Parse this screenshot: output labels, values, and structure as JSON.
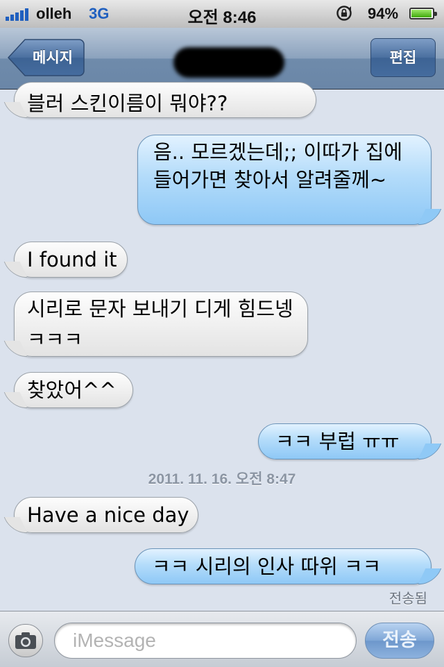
{
  "status_bar": {
    "carrier": "olleh",
    "network": "3G",
    "time": "오전 8:46",
    "battery_percent": "94%",
    "battery_level": 0.94,
    "icons": [
      "signal-icon",
      "rotation-lock-icon",
      "battery-icon"
    ]
  },
  "nav": {
    "back_label": "메시지",
    "edit_label": "편집"
  },
  "messages": [
    {
      "side": "received",
      "text": "블러 스킨이름이 뭐야??"
    },
    {
      "side": "sent",
      "text": "음.. 모르겠는데;; 이따가 집에 들어가면 찾아서 알려줄께~"
    },
    {
      "side": "received",
      "text": "I found it"
    },
    {
      "side": "received",
      "text": "시리로 문자 보내기 디게 힘드넹ㅋㅋㅋ"
    },
    {
      "side": "received",
      "text": "찾았어^^"
    },
    {
      "side": "sent",
      "text": "ㅋㅋ 부럽 ㅠㅠ"
    },
    {
      "side": "received",
      "text": "Have a nice day"
    },
    {
      "side": "sent",
      "text": "ㅋㅋ 시리의 인사 따위 ㅋㅋ"
    }
  ],
  "timestamp": "2011. 11. 16. 오전 8:47",
  "delivered_label": "전송됨",
  "composer": {
    "placeholder": "iMessage",
    "send_label": "전송",
    "colors": {
      "sent_bubble": "#b4dcfa",
      "received_bubble": "#f0f0f0",
      "background": "#dbe2ed"
    }
  }
}
